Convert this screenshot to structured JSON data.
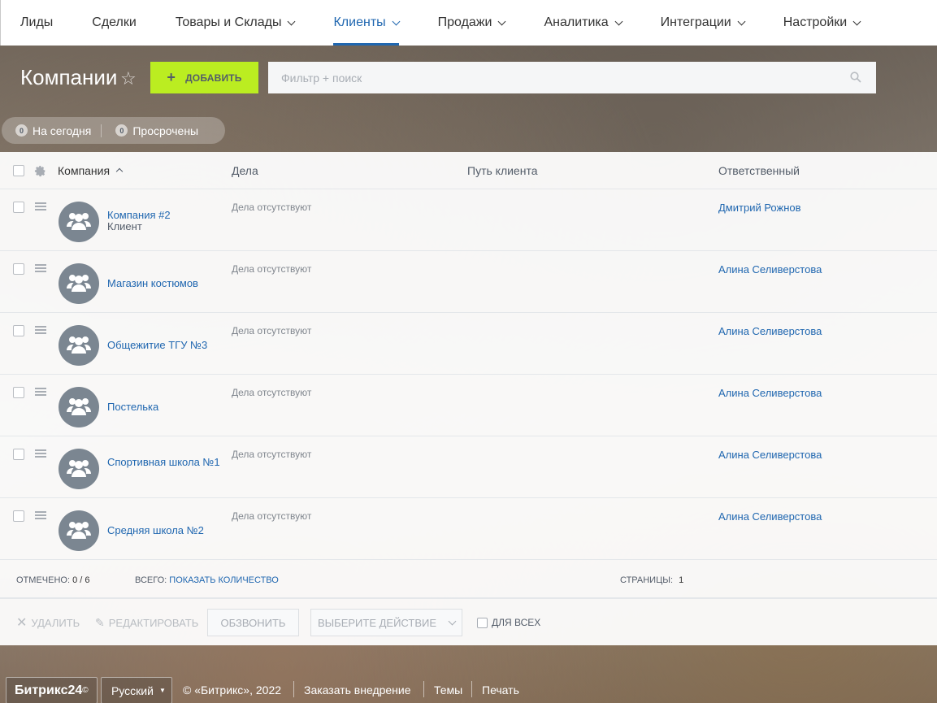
{
  "nav": {
    "items": [
      {
        "label": "Лиды",
        "dropdown": false,
        "active": false
      },
      {
        "label": "Сделки",
        "dropdown": false,
        "active": false
      },
      {
        "label": "Товары и Склады",
        "dropdown": true,
        "active": false
      },
      {
        "label": "Клиенты",
        "dropdown": true,
        "active": true
      },
      {
        "label": "Продажи",
        "dropdown": true,
        "active": false
      },
      {
        "label": "Аналитика",
        "dropdown": true,
        "active": false
      },
      {
        "label": "Интеграции",
        "dropdown": true,
        "active": false
      },
      {
        "label": "Настройки",
        "dropdown": true,
        "active": false
      }
    ]
  },
  "toolbar": {
    "title": "Компании",
    "add_label": "ДОБАВИТЬ",
    "search_placeholder": "Фильтр + поиск"
  },
  "counters": [
    {
      "num": "0",
      "label": "На сегодня"
    },
    {
      "num": "0",
      "label": "Просрочены"
    }
  ],
  "grid": {
    "columns": {
      "company": "Компания",
      "deals": "Дела",
      "path": "Путь клиента",
      "responsible": "Ответственный"
    },
    "rows": [
      {
        "name": "Компания #2",
        "sub": "Клиент",
        "deals": "Дела отсутствуют",
        "responsible": "Дмитрий Рожнов"
      },
      {
        "name": "Магазин костюмов",
        "sub": "",
        "deals": "Дела отсутствуют",
        "responsible": "Алина Селиверстова"
      },
      {
        "name": "Общежитие ТГУ №3",
        "sub": "",
        "deals": "Дела отсутствуют",
        "responsible": "Алина Селиверстова"
      },
      {
        "name": "Постелька",
        "sub": "",
        "deals": "Дела отсутствуют",
        "responsible": "Алина Селиверстова"
      },
      {
        "name": "Спортивная школа №1",
        "sub": "",
        "deals": "Дела отсутствуют",
        "responsible": "Алина Селиверстова"
      },
      {
        "name": "Средняя школа №2",
        "sub": "",
        "deals": "Дела отсутствуют",
        "responsible": "Алина Селиверстова"
      }
    ],
    "footer": {
      "selected_label": "ОТМЕЧЕНО:",
      "selected_value": "0 / 6",
      "total_label": "ВСЕГО:",
      "total_link": "ПОКАЗАТЬ КОЛИЧЕСТВО",
      "pages_label": "СТРАНИЦЫ:",
      "pages_value": "1"
    },
    "actions": {
      "delete": "УДАЛИТЬ",
      "edit": "РЕДАКТИРОВАТЬ",
      "call": "ОБЗВОНИТЬ",
      "choose": "ВЫБЕРИТЕ ДЕЙСТВИЕ",
      "for_all": "ДЛЯ ВСЕХ"
    }
  },
  "footer": {
    "brand": "Битрикс24",
    "brand_mark": "©",
    "language": "Русский",
    "copyright": "© «Битрикс», 2022",
    "order_link": "Заказать внедрение",
    "themes_link": "Темы",
    "print_link": "Печать"
  },
  "colors": {
    "accent": "#2067b0",
    "add_button": "#bbed21"
  }
}
